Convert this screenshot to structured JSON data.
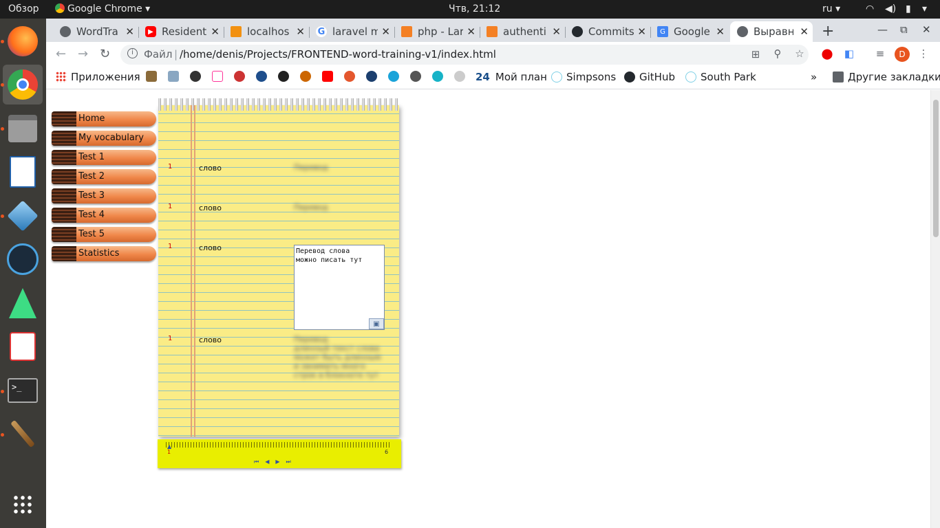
{
  "topbar": {
    "overview": "Обзор",
    "app": "Google Chrome ▾",
    "clock": "Чтв, 21:12",
    "lang": "ru ▾"
  },
  "tabs": [
    {
      "title": "WordTra",
      "color": "#5f6368"
    },
    {
      "title": "Resident",
      "color": "#ff0000"
    },
    {
      "title": "localhos",
      "color": "#f29111"
    },
    {
      "title": "laravel m",
      "color": "#4285f4"
    },
    {
      "title": "php - Lar",
      "color": "#f48024"
    },
    {
      "title": "authenti",
      "color": "#f48024"
    },
    {
      "title": "Commits",
      "color": "#24292e"
    },
    {
      "title": "Google P",
      "color": "#4285f4"
    },
    {
      "title": "Выравн",
      "color": "#5f6368"
    }
  ],
  "omnibox": {
    "scheme": "Файл",
    "url": "/home/denis/Projects/FRONTEND-word-training-v1/index.html"
  },
  "account_initial": "D",
  "bookmarks": {
    "apps": "Приложения",
    "plan_num": "24",
    "plan": "Мой план",
    "simpsons": "Simpsons",
    "github": "GitHub",
    "southpark": "South Park",
    "more": "»",
    "other": "Другие закладки"
  },
  "menu": [
    "Home",
    "My vocabulary",
    "Test 1",
    "Test 2",
    "Test 3",
    "Test 4",
    "Test 5",
    "Statistics"
  ],
  "rows": [
    {
      "num": "1",
      "word": "слово",
      "translation": "Перевод"
    },
    {
      "num": "1",
      "word": "слово",
      "translation": "Перевод"
    },
    {
      "num": "1",
      "word": "слово",
      "translation": ""
    },
    {
      "num": "1",
      "word": "слово",
      "translation": "Перевод\nдлинный текст слова\nможет быть длинным\nи занимать много\nстрок в блокноте тут"
    }
  ],
  "edit_box_text": "Перевод слова\nможно писать тут",
  "ruler": {
    "start": "1",
    "end": "6"
  }
}
